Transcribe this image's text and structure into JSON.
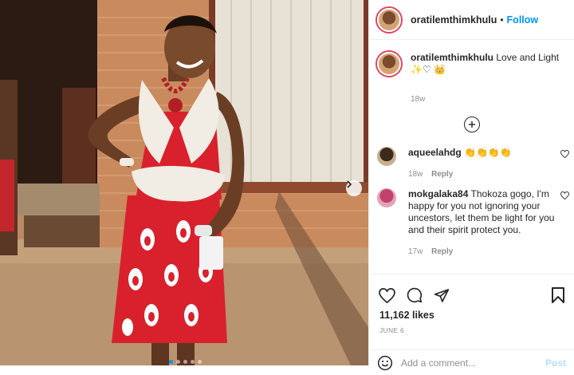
{
  "post": {
    "author": "oratilemthimkhulu",
    "follow_label": "Follow",
    "separator": "•"
  },
  "caption": {
    "username": "oratilemthimkhulu",
    "text": "Love and Light ✨♡ 👑",
    "age": "18w"
  },
  "comments": [
    {
      "username": "aqueelahdg",
      "text": "👏👏👏👏",
      "age": "18w",
      "reply_label": "Reply"
    },
    {
      "username": "mokgalaka84",
      "text": "Thokoza gogo, I'm happy for you not ignoring your uncestors, let them be light for you and their spirit protect you.",
      "age": "17w",
      "reply_label": "Reply"
    }
  ],
  "stats": {
    "likes": "11,162 likes",
    "date": "JUNE 6"
  },
  "composer": {
    "placeholder": "Add a comment...",
    "post_label": "Post"
  },
  "carousel": {
    "current": 1,
    "total": 5
  },
  "colors": {
    "link_blue": "#0095f6",
    "post_disabled": "#b2dffc",
    "story_ring": "#e4405f",
    "muted": "#8e8e8e"
  },
  "icons": [
    "heart-icon",
    "comment-icon",
    "share-icon",
    "bookmark-icon",
    "emoji-icon",
    "plus-circle-icon",
    "chevron-right-icon"
  ]
}
